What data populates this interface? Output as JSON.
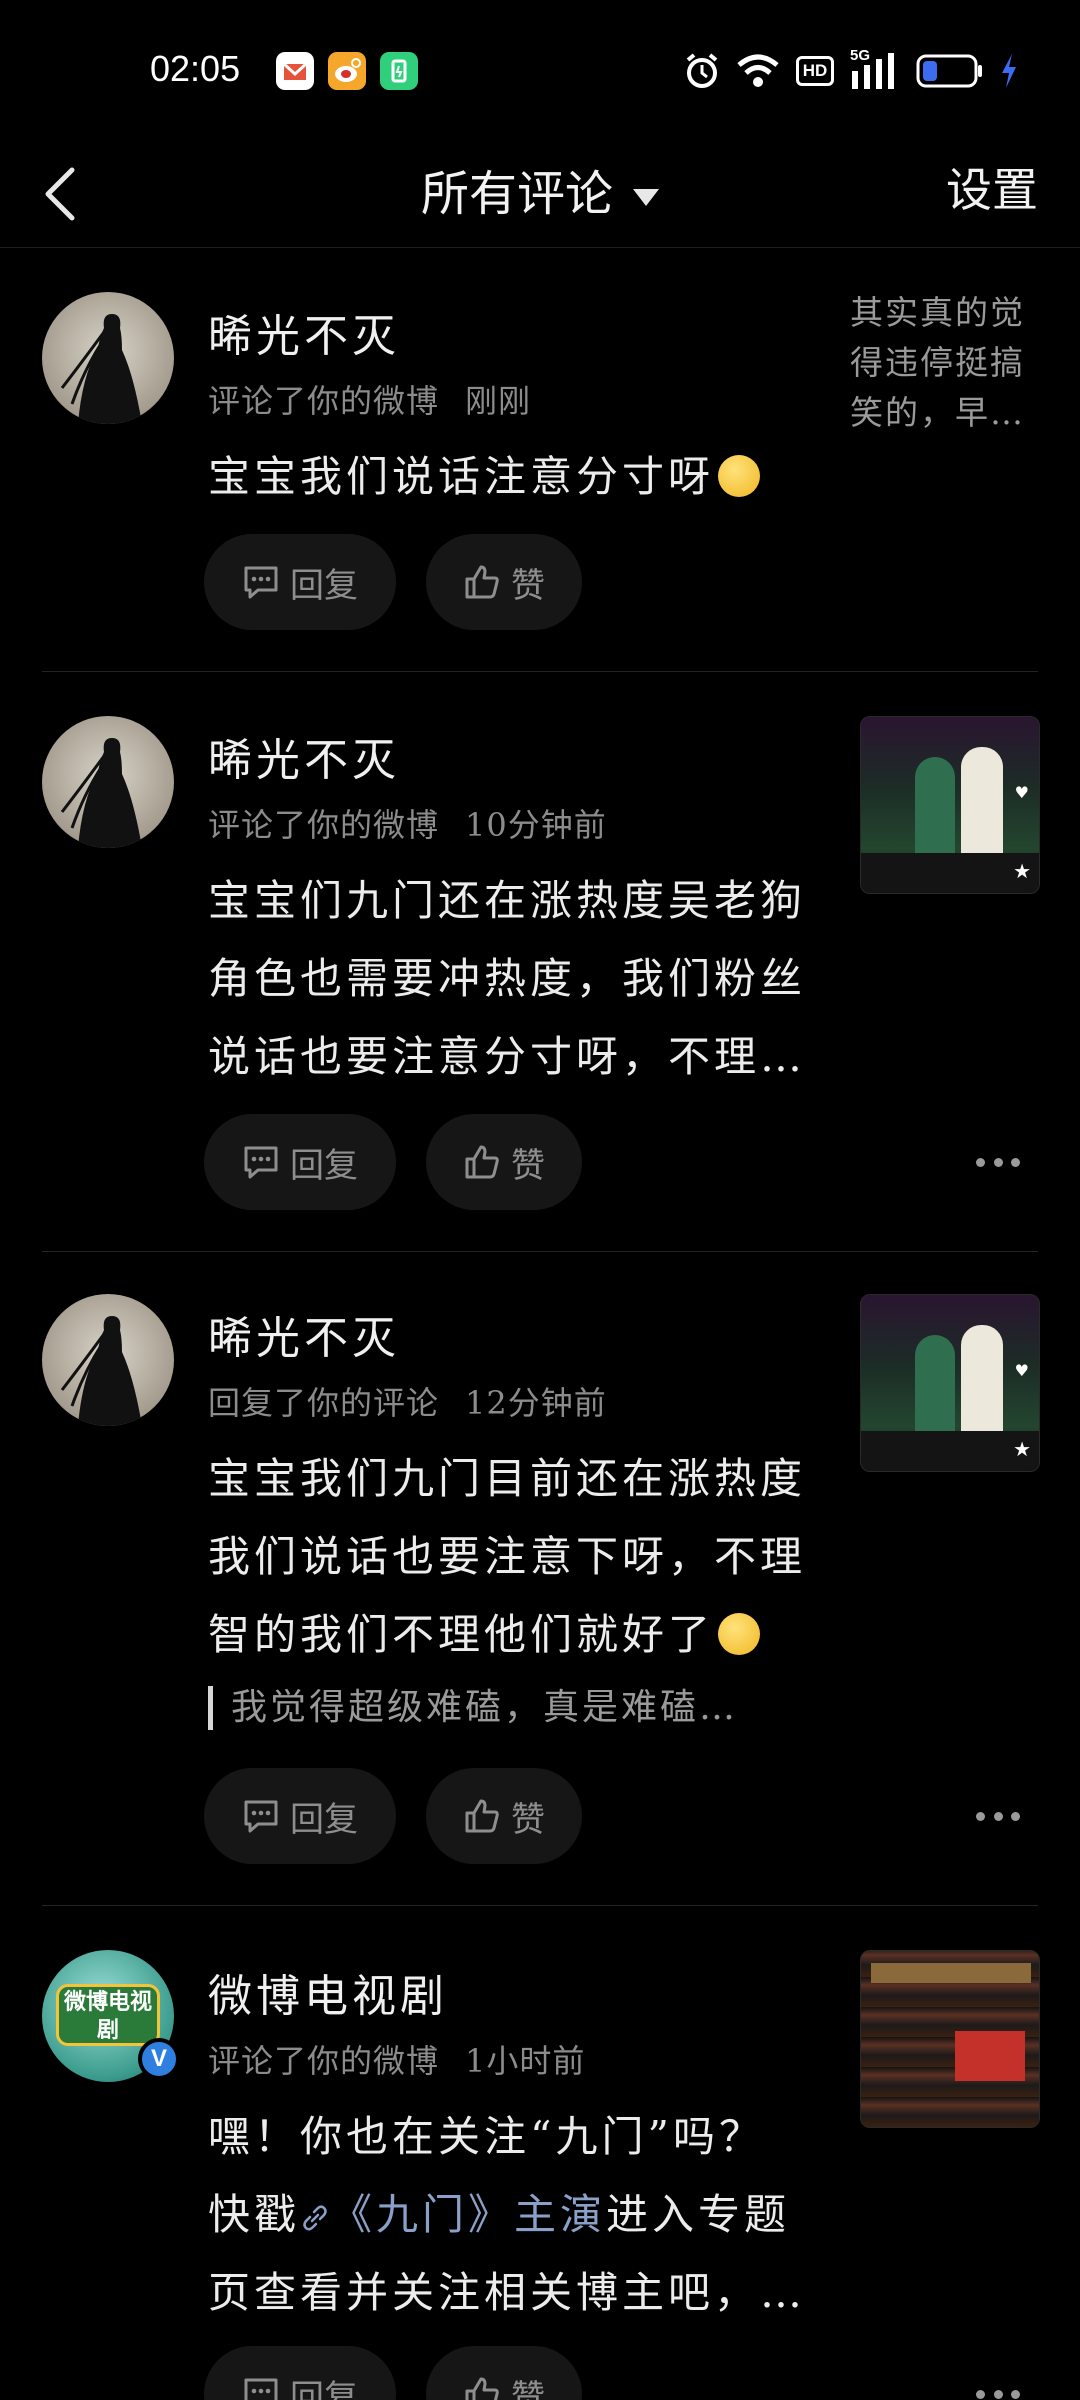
{
  "status_bar": {
    "time": "02:05",
    "hd_label": "HD",
    "network_label": "5G",
    "app_icons": [
      "message-app-icon",
      "weibo-app-icon",
      "green-app-icon"
    ],
    "right_icons": [
      "alarm-icon",
      "wifi-icon",
      "hd-badge",
      "signal-icon",
      "battery-icon",
      "charging-icon"
    ]
  },
  "nav": {
    "title": "所有评论",
    "settings_label": "设置"
  },
  "actions": {
    "reply_label": "回复",
    "like_label": "赞"
  },
  "comments": [
    {
      "username": "晞光不灭",
      "action": "评论了你的微博",
      "time": "刚刚",
      "content": "宝宝我们说话注意分寸呀",
      "preview_text": "其实真的觉得违停挺搞笑的，早…"
    },
    {
      "username": "晞光不灭",
      "action": "评论了你的微博",
      "time": "10分钟前",
      "content_lines": [
        "宝宝们九门还在涨热度吴老狗",
        "角色也需要冲热度，我们粉丝",
        "说话也要注意分寸呀，不理…"
      ]
    },
    {
      "username": "晞光不灭",
      "action": "回复了你的评论",
      "time": "12分钟前",
      "content_lines": [
        "宝宝我们九门目前还在涨热度",
        "我们说话也要注意下呀，不理",
        "智的我们不理他们就好了"
      ],
      "quote": "我觉得超级难磕，真是难磕…"
    },
    {
      "username": "微博电视剧",
      "avatar_text": "微博电视剧",
      "verified_mark": "V",
      "action": "评论了你的微博",
      "time": "1小时前",
      "content_line1": "嘿！你也在关注“九门”吗？",
      "content_line2_prefix": "快戳",
      "content_link": "《九门》主演",
      "content_line2_suffix": "进入专题",
      "content_line3": "页查看并关注相关博主吧，…"
    }
  ],
  "colors": {
    "background": "#000000",
    "text_primary": "#ececec",
    "text_secondary": "#8c8c8c",
    "button_bg": "#161616",
    "link": "#8aa0c8",
    "verified": "#2f7fe0"
  }
}
